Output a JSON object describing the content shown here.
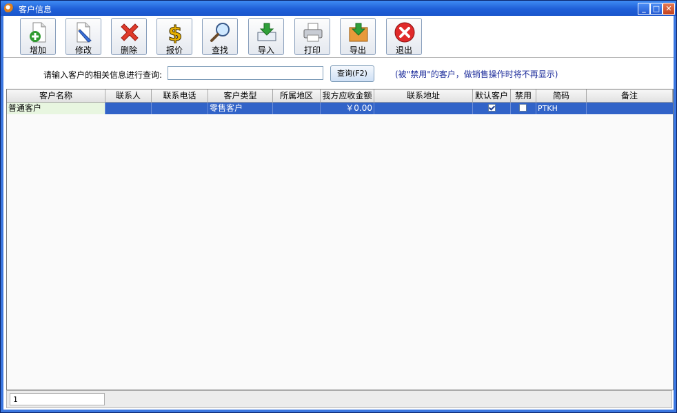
{
  "window": {
    "title": "客户信息",
    "minimize": "_",
    "maximize": "□",
    "close": "✕"
  },
  "toolbar": {
    "add": "增加",
    "edit": "修改",
    "delete": "删除",
    "quote": "报价",
    "find": "查找",
    "import": "导入",
    "print": "打印",
    "export": "导出",
    "exit": "退出"
  },
  "search": {
    "label": "请输入客户的相关信息进行查询:",
    "value": "",
    "button": "查询(F2)",
    "note": "(被\"禁用\"的客户，做销售操作时将不再显示)"
  },
  "table": {
    "columns": [
      "客户名称",
      "联系人",
      "联系电话",
      "客户类型",
      "所属地区",
      "我方应收金额",
      "联系地址",
      "默认客户",
      "禁用",
      "简码",
      "备注"
    ],
    "rows": [
      {
        "name": "普通客户",
        "contact": "",
        "phone": "",
        "type": "零售客户",
        "region": "",
        "amount": "￥0.00",
        "address": "",
        "default": true,
        "disabled": false,
        "code": "PTKH",
        "remark": ""
      }
    ]
  },
  "status": {
    "count": "1"
  },
  "colors": {
    "title_bar": "#1f5fd8",
    "selected_row": "#3163c8",
    "note_text": "#1a2a9a"
  }
}
